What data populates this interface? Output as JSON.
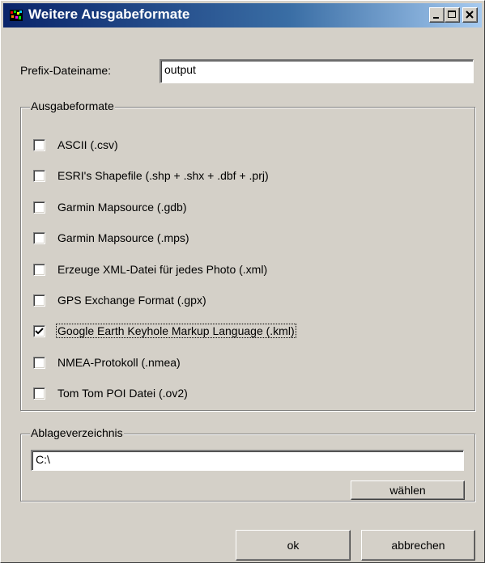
{
  "window": {
    "title": "Weitere Ausgabeformate",
    "icon": "app-icon"
  },
  "prefix": {
    "label": "Prefix-Dateiname:",
    "value": "output"
  },
  "formats": {
    "group_title": "Ausgabeformate",
    "items": [
      {
        "label": "ASCII (.csv)",
        "checked": false
      },
      {
        "label": "ESRI's Shapefile (.shp + .shx + .dbf + .prj)",
        "checked": false
      },
      {
        "label": "Garmin Mapsource (.gdb)",
        "checked": false
      },
      {
        "label": "Garmin Mapsource (.mps)",
        "checked": false
      },
      {
        "label": "Erzeuge XML-Datei für jedes Photo (.xml)",
        "checked": false
      },
      {
        "label": "GPS Exchange Format (.gpx)",
        "checked": false
      },
      {
        "label": "Google Earth Keyhole Markup Language (.kml)",
        "checked": true
      },
      {
        "label": "NMEA-Protokoll (.nmea)",
        "checked": false
      },
      {
        "label": "Tom Tom POI Datei (.ov2)",
        "checked": false
      }
    ]
  },
  "folder": {
    "group_title": "Ablageverzeichnis",
    "value": "C:\\",
    "choose_label": "wählen"
  },
  "buttons": {
    "ok_label": "ok",
    "cancel_label": "abbrechen"
  },
  "colors": {
    "face": "#d4d0c8",
    "title_start": "#0a246a",
    "title_end": "#a6caf0"
  }
}
